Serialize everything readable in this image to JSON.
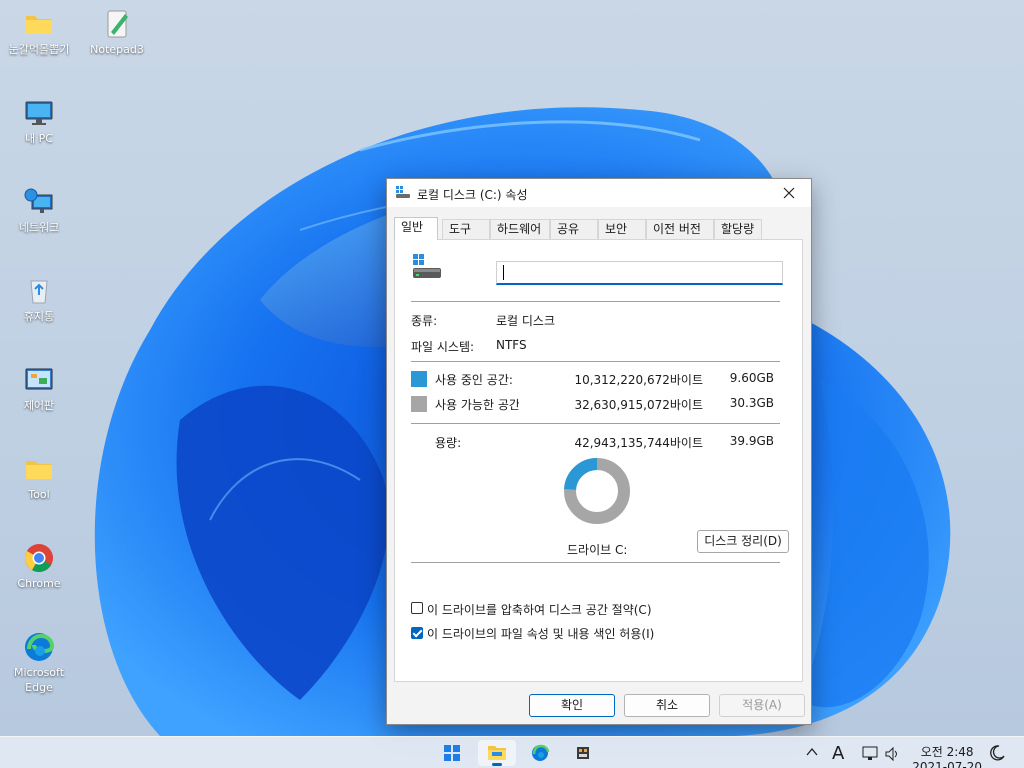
{
  "desktop": {
    "icons": [
      {
        "label": "눈갈먹몰뽑기"
      },
      {
        "label": "Notepad3"
      },
      {
        "label": "내 PC"
      },
      {
        "label": "네트워크"
      },
      {
        "label": "휴지통"
      },
      {
        "label": "제어판"
      },
      {
        "label": "Tool"
      },
      {
        "label": "Chrome"
      },
      {
        "label": "Microsoft\nEdge"
      }
    ]
  },
  "dialog": {
    "title": "로컬 디스크 (C:) 속성",
    "tabs": [
      {
        "label": "일반"
      },
      {
        "label": "도구"
      },
      {
        "label": "하드웨어"
      },
      {
        "label": "공유"
      },
      {
        "label": "보안"
      },
      {
        "label": "이전 버전"
      },
      {
        "label": "할당량"
      }
    ],
    "active_tab": "일반",
    "volume_name": "",
    "type_label": "종류:",
    "type_value": "로컬 디스크",
    "fs_label": "파일 시스템:",
    "fs_value": "NTFS",
    "used": {
      "label": "사용 중인 공간:",
      "bytes": "10,312,220,672바이트",
      "size": "9.60GB",
      "color": "#2a98d4"
    },
    "free": {
      "label": "사용 가능한 공간:",
      "bytes": "32,630,915,072바이트",
      "size": "30.3GB",
      "color": "#a6a6a6"
    },
    "capacity": {
      "label": "용량:",
      "bytes": "42,943,135,744바이트",
      "size": "39.9GB"
    },
    "used_fraction": 0.24,
    "drive_label": "드라이브 C:",
    "cleanup_button": "디스크 정리(D)",
    "compress": {
      "label": "이 드라이브를 압축하여 디스크 공간 절약(C)",
      "checked": false
    },
    "index": {
      "label": "이 드라이브의 파일 속성 및 내용 색인 허용(I)",
      "checked": true
    },
    "buttons": {
      "ok": "확인",
      "cancel": "취소",
      "apply": "적용(A)"
    }
  },
  "taskbar": {
    "items": [
      "start-icon",
      "file-explorer-icon",
      "edge-icon",
      "app-icon"
    ],
    "tray": {
      "input_indicator": "A",
      "time": "오전 2:48",
      "date": "2021-07-20"
    }
  }
}
